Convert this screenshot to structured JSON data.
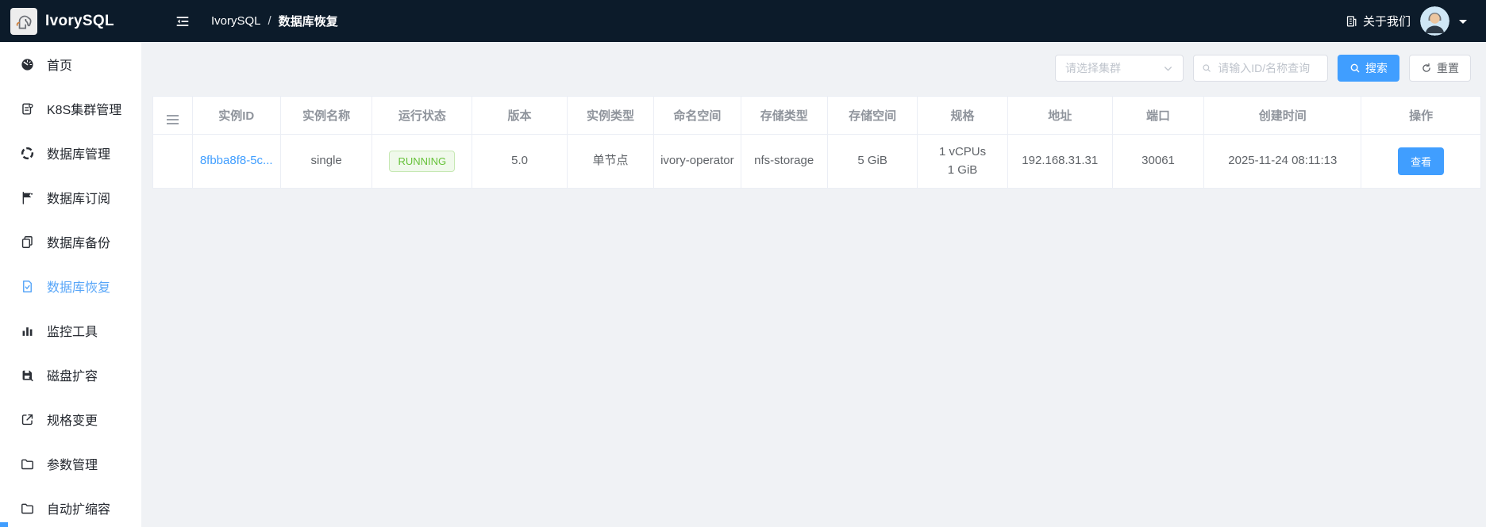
{
  "navbar": {
    "brand": "IvorySQL",
    "breadcrumb_root": "IvorySQL",
    "breadcrumb_separator": "/",
    "breadcrumb_current": "数据库恢复",
    "about_label": "关于我们"
  },
  "sidebar": {
    "items": [
      {
        "label": "首页",
        "icon": "dashboard-icon",
        "active": false
      },
      {
        "label": "K8S集群管理",
        "icon": "cluster-icon",
        "active": false
      },
      {
        "label": "数据库管理",
        "icon": "database-manage-icon",
        "active": false
      },
      {
        "label": "数据库订阅",
        "icon": "subscription-icon",
        "active": false
      },
      {
        "label": "数据库备份",
        "icon": "backup-icon",
        "active": false
      },
      {
        "label": "数据库恢复",
        "icon": "restore-icon",
        "active": true
      },
      {
        "label": "监控工具",
        "icon": "monitor-icon",
        "active": false
      },
      {
        "label": "磁盘扩容",
        "icon": "disk-icon",
        "active": false
      },
      {
        "label": "规格变更",
        "icon": "spec-change-icon",
        "active": false
      },
      {
        "label": "参数管理",
        "icon": "folder-icon",
        "active": false
      },
      {
        "label": "自动扩缩容",
        "icon": "folder-icon",
        "active": false
      }
    ]
  },
  "filters": {
    "cluster_select_placeholder": "请选择集群",
    "search_placeholder": "请输入ID/名称查询",
    "search_button": "搜索",
    "reset_button": "重置"
  },
  "table": {
    "columns": [
      "",
      "实例ID",
      "实例名称",
      "运行状态",
      "版本",
      "实例类型",
      "命名空间",
      "存储类型",
      "存储空间",
      "规格",
      "地址",
      "端口",
      "创建时间",
      "操作"
    ],
    "rows": [
      {
        "instance_id": "8fbba8f8-5c...",
        "instance_name": "single",
        "status": "RUNNING",
        "version": "5.0",
        "instance_type": "单节点",
        "namespace": "ivory-operator",
        "storage_type": "nfs-storage",
        "storage_size": "5 GiB",
        "spec_line1": "1 vCPUs",
        "spec_line2": "1 GiB",
        "address": "192.168.31.31",
        "port": "30061",
        "created_at": "2025-11-24 08:11:13",
        "action_label": "查看"
      }
    ]
  },
  "colors": {
    "navbar_bg": "#0c1b2a",
    "accent": "#409eff",
    "sidebar_active": "#58a6f8",
    "success_text": "#67c23a",
    "success_bg": "#f0f9eb"
  }
}
